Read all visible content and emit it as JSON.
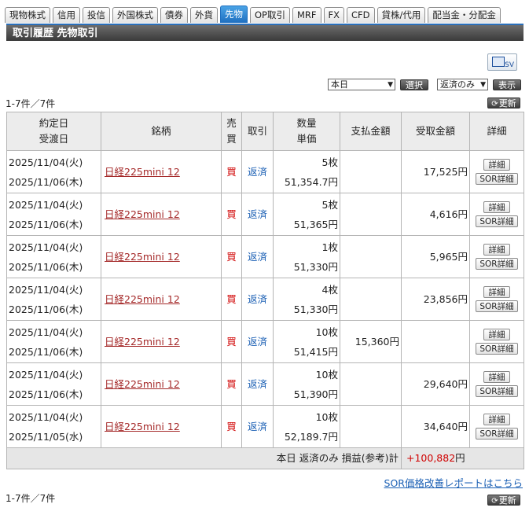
{
  "tabs": [
    "現物株式",
    "信用",
    "投信",
    "外国株式",
    "債券",
    "外貨",
    "先物",
    "OP取引",
    "MRF",
    "FX",
    "CFD",
    "貸株/代用",
    "配当金・分配金"
  ],
  "active_tab": 6,
  "title": "取引履歴 先物取引",
  "csv_label": "CSV",
  "filters": {
    "period": "本日",
    "select_button": "選択",
    "status": "返済のみ",
    "show_button": "表示"
  },
  "count_text": "1-7件／7件",
  "refresh_label": "更新",
  "headers": {
    "date": "約定日",
    "settle": "受渡日",
    "name": "銘柄",
    "side1": "売",
    "side2": "買",
    "type": "取引",
    "qty": "数量",
    "price": "単価",
    "pay": "支払金額",
    "recv": "受取金額",
    "detail": "詳細"
  },
  "rows": [
    {
      "trade_date": "2025/11/04(火)",
      "settle_date": "2025/11/06(木)",
      "name": "日経225mini 12",
      "side": "買",
      "type": "返済",
      "qty": "5枚",
      "price": "51,354.7円",
      "pay": "",
      "recv": "17,525円"
    },
    {
      "trade_date": "2025/11/04(火)",
      "settle_date": "2025/11/06(木)",
      "name": "日経225mini 12",
      "side": "買",
      "type": "返済",
      "qty": "5枚",
      "price": "51,365円",
      "pay": "",
      "recv": "4,616円"
    },
    {
      "trade_date": "2025/11/04(火)",
      "settle_date": "2025/11/06(木)",
      "name": "日経225mini 12",
      "side": "買",
      "type": "返済",
      "qty": "1枚",
      "price": "51,330円",
      "pay": "",
      "recv": "5,965円"
    },
    {
      "trade_date": "2025/11/04(火)",
      "settle_date": "2025/11/06(木)",
      "name": "日経225mini 12",
      "side": "買",
      "type": "返済",
      "qty": "4枚",
      "price": "51,330円",
      "pay": "",
      "recv": "23,856円"
    },
    {
      "trade_date": "2025/11/04(火)",
      "settle_date": "2025/11/06(木)",
      "name": "日経225mini 12",
      "side": "買",
      "type": "返済",
      "qty": "10枚",
      "price": "51,415円",
      "pay": "15,360円",
      "recv": ""
    },
    {
      "trade_date": "2025/11/04(火)",
      "settle_date": "2025/11/06(木)",
      "name": "日経225mini 12",
      "side": "買",
      "type": "返済",
      "qty": "10枚",
      "price": "51,390円",
      "pay": "",
      "recv": "29,640円"
    },
    {
      "trade_date": "2025/11/04(火)",
      "settle_date": "2025/11/05(水)",
      "name": "日経225mini 12",
      "side": "買",
      "type": "返済",
      "qty": "10枚",
      "price": "52,189.7円",
      "pay": "",
      "recv": "34,640円"
    }
  ],
  "detail_label": "詳細",
  "sor_detail_label": "SOR詳細",
  "summary": {
    "label": "本日 返済のみ 損益(参考)計",
    "value": "+100,882",
    "unit": "円"
  },
  "sor_link": "SOR価格改善レポートはこちら",
  "colors": {
    "active_tab": "#1f6fc0",
    "buy": "#d00000",
    "link": "#1a5fb4",
    "name_link": "#a52a2a"
  }
}
